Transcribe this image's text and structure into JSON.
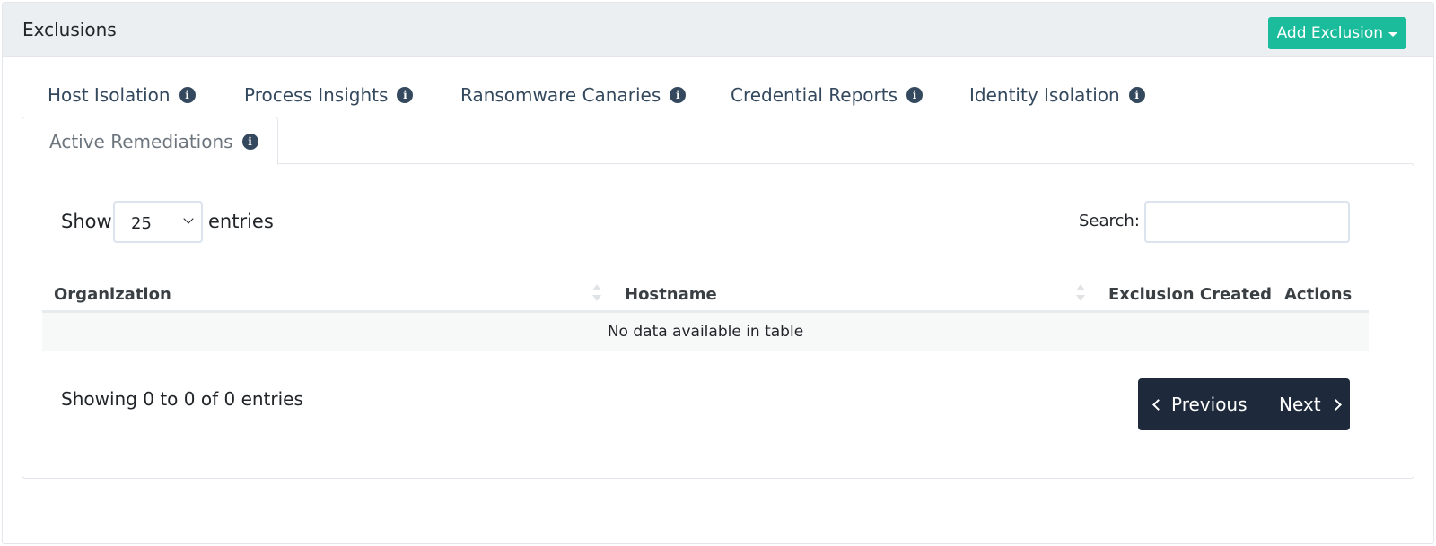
{
  "header": {
    "title": "Exclusions",
    "add_button_label": "Add Exclusion"
  },
  "tabs": [
    {
      "label": "Host Isolation",
      "icon": "info-icon"
    },
    {
      "label": "Process Insights",
      "icon": "info-icon"
    },
    {
      "label": "Ransomware Canaries",
      "icon": "info-icon"
    },
    {
      "label": "Credential Reports",
      "icon": "info-icon"
    },
    {
      "label": "Identity Isolation",
      "icon": "info-icon"
    },
    {
      "label": "Active Remediations",
      "icon": "info-icon",
      "active": true
    }
  ],
  "table_controls": {
    "show_label": "Show",
    "page_size": "25",
    "entries_label": "entries",
    "search_label": "Search:",
    "search_value": ""
  },
  "table": {
    "columns": [
      "Organization",
      "Hostname",
      "Exclusion Created",
      "Actions"
    ],
    "empty_message": "No data available in table"
  },
  "footer": {
    "info": "Showing 0 to 0 of 0 entries",
    "previous_label": "Previous",
    "next_label": "Next"
  },
  "colors": {
    "accent": "#1abc9c",
    "tab_text": "#34495e",
    "pager_bg": "#1e2a3b",
    "header_bg": "#eceff1"
  }
}
